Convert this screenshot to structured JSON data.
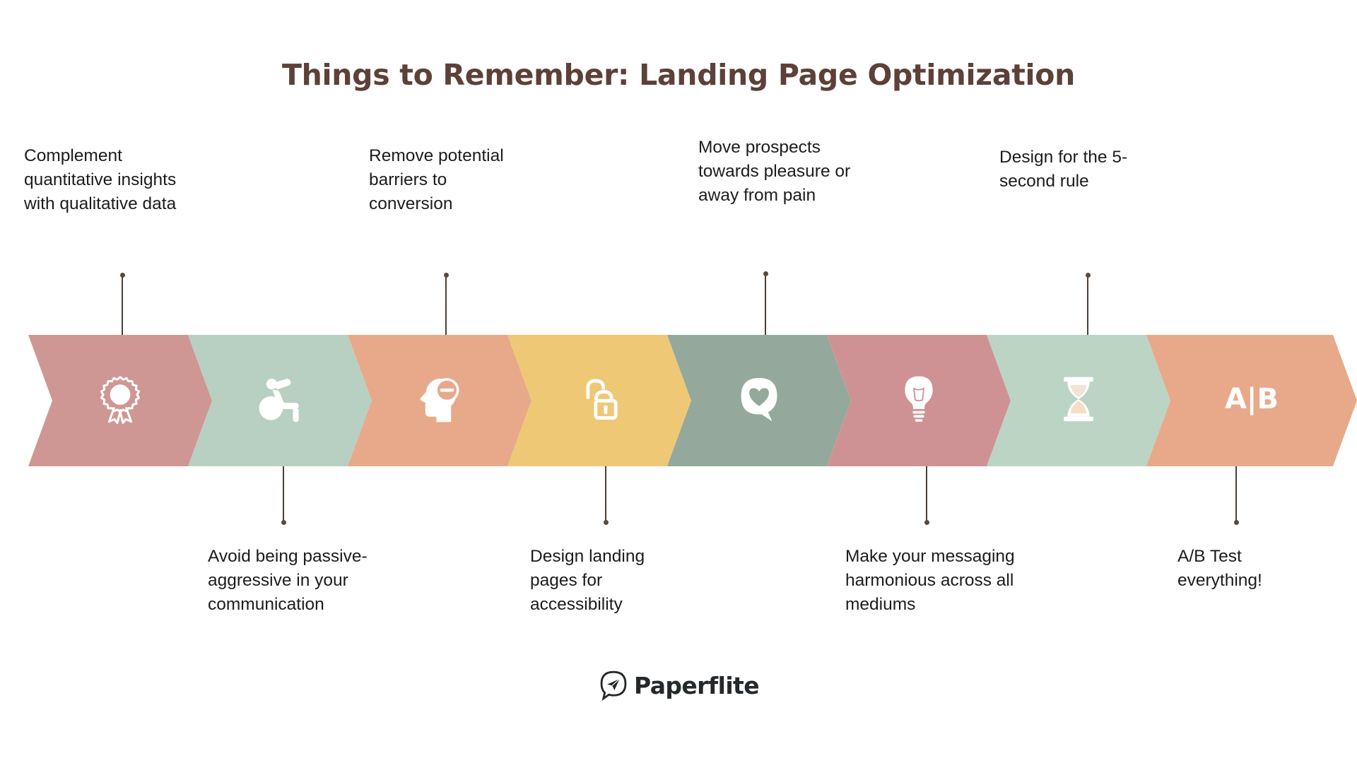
{
  "title": "Things to Remember: Landing Page Optimization",
  "theme": {
    "background": "#ffffff",
    "title_color": "#5d4038",
    "label_color": "#1c1c1c",
    "connector_color": "#4a4038",
    "icon_color": "#ffffff"
  },
  "steps": [
    {
      "index": 1,
      "color": "#cf9794",
      "icon": "award-ribbon-icon",
      "label": "Complement\nquantitative insights\nwith qualitative data",
      "label_position": "top"
    },
    {
      "index": 2,
      "color": "#b8d0c1",
      "icon": "wheelchair-accessibility-icon",
      "label": "Avoid being passive-\naggressive in your\ncommunication",
      "label_position": "bottom"
    },
    {
      "index": 3,
      "color": "#e8a98a",
      "icon": "head-minus-barrier-icon",
      "label": "Remove potential\nbarriers to\nconversion",
      "label_position": "top"
    },
    {
      "index": 4,
      "color": "#eec875",
      "icon": "open-padlock-icon",
      "label": "Design landing\npages for\naccessibility",
      "label_position": "bottom"
    },
    {
      "index": 5,
      "color": "#94a99b",
      "icon": "speech-bubble-heart-icon",
      "label": "Move prospects\ntowards pleasure or\naway from pain",
      "label_position": "top"
    },
    {
      "index": 6,
      "color": "#cf9294",
      "icon": "lightbulb-icon",
      "label": "Make your messaging\nharmonious across all\nmediums",
      "label_position": "bottom"
    },
    {
      "index": 7,
      "color": "#bcd4c4",
      "icon": "hourglass-icon",
      "label": "Design for the 5-\nsecond rule",
      "label_position": "top"
    },
    {
      "index": 8,
      "color": "#e8a98a",
      "icon": "ab-test-icon",
      "icon_text": "A|B",
      "label": "A/B Test\neverything!",
      "label_position": "bottom"
    }
  ],
  "footer": {
    "brand": "Paperflite",
    "logo_icon": "paper-plane-speech-bubble-icon"
  }
}
